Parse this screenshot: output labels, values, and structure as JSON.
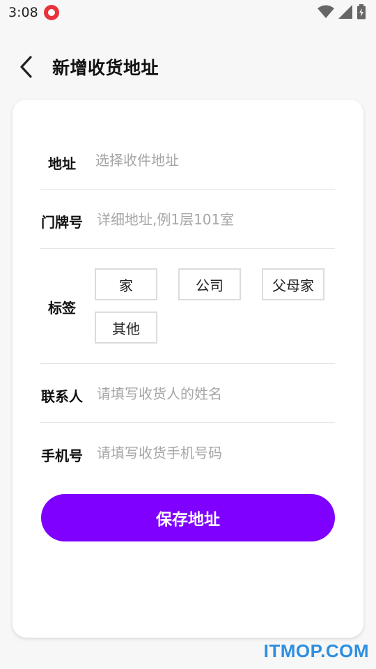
{
  "status_bar": {
    "time": "3:08",
    "app_icon": "red-mascot-icon",
    "icons": [
      "wifi-icon",
      "signal-icon",
      "battery-icon"
    ]
  },
  "header": {
    "back_icon": "chevron-left-icon",
    "title": "新增收货地址"
  },
  "form": {
    "address": {
      "label": "地址",
      "placeholder": "选择收件地址"
    },
    "door_number": {
      "label": "门牌号",
      "placeholder": "详细地址,例1层101室"
    },
    "tags": {
      "label": "标签",
      "options": [
        "家",
        "公司",
        "父母家",
        "其他"
      ]
    },
    "contact": {
      "label": "联系人",
      "placeholder": "请填写收货人的姓名"
    },
    "phone": {
      "label": "手机号",
      "placeholder": "请填写收货手机号码"
    }
  },
  "save_button_label": "保存地址",
  "watermark": "ITMOP.COM",
  "colors": {
    "accent": "#7f00ff",
    "background": "#f7f7f7",
    "watermark": "#2e8fe0"
  }
}
